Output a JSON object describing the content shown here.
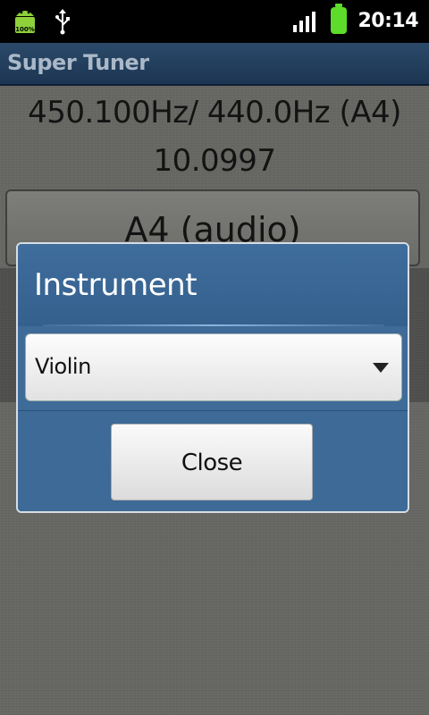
{
  "status_bar": {
    "battery_badge": "100%",
    "clock": "20:14",
    "icons": [
      "android-battery-icon",
      "usb-icon",
      "signal-icon",
      "battery-icon"
    ]
  },
  "app": {
    "title": "Super Tuner"
  },
  "tuner": {
    "frequency_readout": "450.100Hz/ 440.0Hz (A4)",
    "deviation": "10.0997",
    "note_button": "A4 (audio)"
  },
  "dialog": {
    "title": "Instrument",
    "selected_instrument": "Violin",
    "close_label": "Close"
  },
  "colors": {
    "title_bar": "#1c3552",
    "dialog_blue": "#3e6b98",
    "battery_green": "#5ddc2b"
  }
}
